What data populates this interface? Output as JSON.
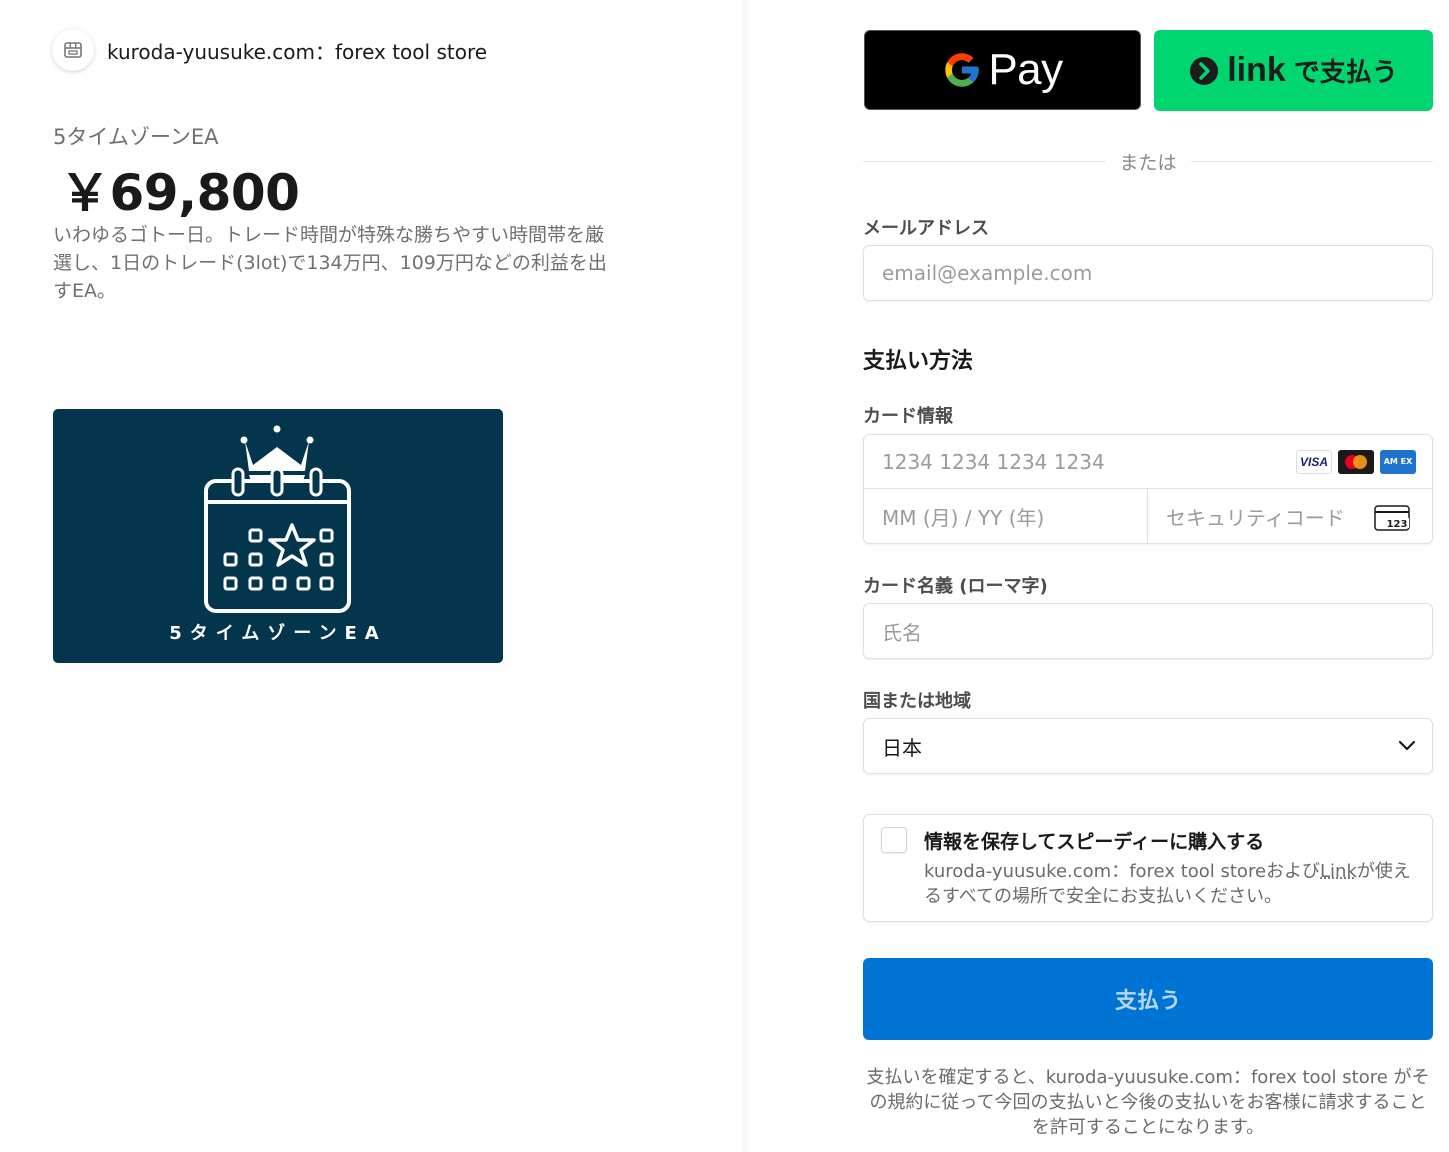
{
  "merchant": {
    "name": "kuroda-yuusuke.com：forex tool store",
    "icon": "storefront-icon"
  },
  "product": {
    "name": "5タイムゾーンEA",
    "price": "￥69,800",
    "description": "いわゆるゴトー日。トレード時間が特殊な勝ちやすい時間帯を厳選し、1日のトレード(3lot)で134万円、109万円などの利益を出すEA。",
    "image_caption": "5タイムゾーンEA",
    "image_bg": "#03364d"
  },
  "wallets": {
    "gpay_label": "Pay",
    "link_word": "link",
    "link_suffix": "で支払う",
    "link_color": "#00d66f"
  },
  "divider_text": "または",
  "email": {
    "label": "メールアドレス",
    "placeholder": "email@example.com"
  },
  "payment": {
    "section_title": "支払い方法",
    "card_label": "カード情報",
    "card_number_placeholder": "1234 1234 1234 1234",
    "brands": [
      "VISA",
      "Mastercard",
      "AMEX"
    ],
    "visa_text": "VISA",
    "amex_text": "AM EX",
    "expiry_placeholder": "MM (月) / YY (年)",
    "cvc_placeholder": "セキュリティコード",
    "cvc_icon_text": "123",
    "cardholder_label": "カード名義 (ローマ字)",
    "cardholder_placeholder": "氏名",
    "country_label": "国または地域",
    "country_value": "日本"
  },
  "save_info": {
    "title": "情報を保存してスピーディーに購入する",
    "desc_prefix": "kuroda-yuusuke.com：forex tool storeおよび",
    "desc_link": "Link",
    "desc_suffix": "が使えるすべての場所で安全にお支払いください。"
  },
  "pay_button": {
    "label": "支払う",
    "color": "#0074d4"
  },
  "terms": "支払いを確定すると、kuroda-yuusuke.com：forex tool store がその規約に従って今回の支払いと今後の支払いをお客様に請求することを許可することになります。"
}
